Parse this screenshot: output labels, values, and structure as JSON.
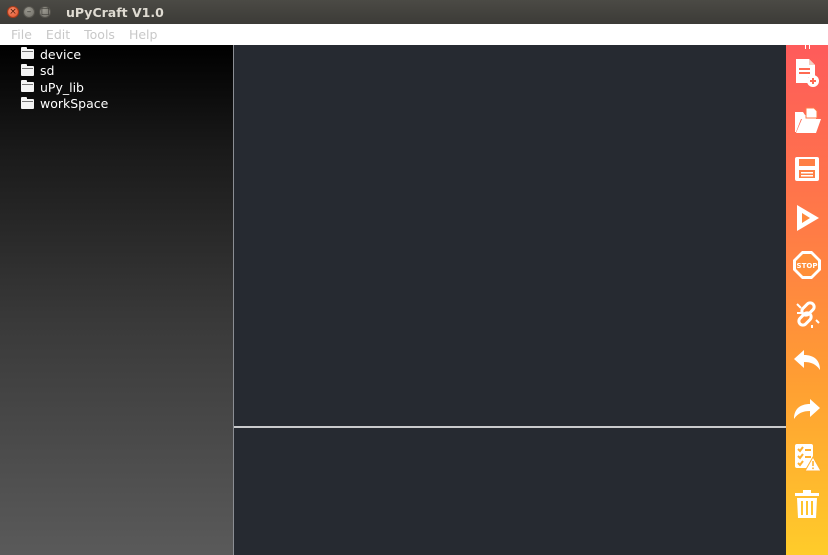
{
  "window": {
    "title": "uPyCraft V1.0",
    "controls": {
      "close": "×",
      "minimize": "–",
      "maximize": "□"
    }
  },
  "menubar": {
    "items": [
      "File",
      "Edit",
      "Tools",
      "Help"
    ]
  },
  "file_tree": {
    "items": [
      "device",
      "sd",
      "uPy_lib",
      "workSpace"
    ]
  },
  "toolbar": {
    "stop_label": "STOP",
    "gradient": [
      "#fe5b5b",
      "#ff7a47",
      "#ff9d33",
      "#ffcc2a"
    ],
    "icons": [
      "new-file-icon",
      "open-folder-icon",
      "save-icon",
      "run-icon",
      "stop-icon",
      "disconnect-icon",
      "undo-icon",
      "redo-icon",
      "syntax-check-icon",
      "clear-icon"
    ]
  },
  "colors": {
    "editor_bg": "#262a31",
    "tree_top": "#000000",
    "tree_bottom": "#5a5a5a",
    "menu_text": "#c8c8c8"
  }
}
